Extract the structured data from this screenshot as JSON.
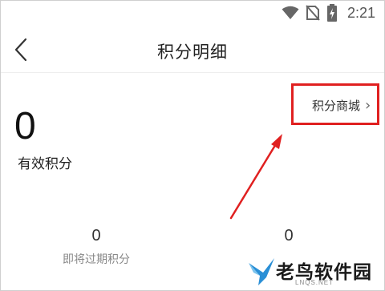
{
  "status_bar": {
    "time": "2:21",
    "icons": [
      "wifi-icon",
      "no-sim-icon",
      "battery-charging-icon"
    ]
  },
  "header": {
    "title": "积分明细",
    "back_icon": "chevron-left-icon"
  },
  "points_mall": {
    "label": "积分商城",
    "chevron": "›",
    "highlight_color": "#e02020"
  },
  "summary": {
    "valid_points_value": "0",
    "valid_points_label": "有效积分"
  },
  "stats": [
    {
      "value": "0",
      "label": "即将过期积分"
    },
    {
      "value": "0",
      "label": ""
    }
  ],
  "watermark": {
    "text": "老鸟软件园",
    "subtext": "LNQS.NET"
  },
  "colors": {
    "annotation": "#e02020",
    "text_primary": "#222222",
    "text_secondary": "#888888",
    "logo_blue": "#2a8fd6"
  }
}
